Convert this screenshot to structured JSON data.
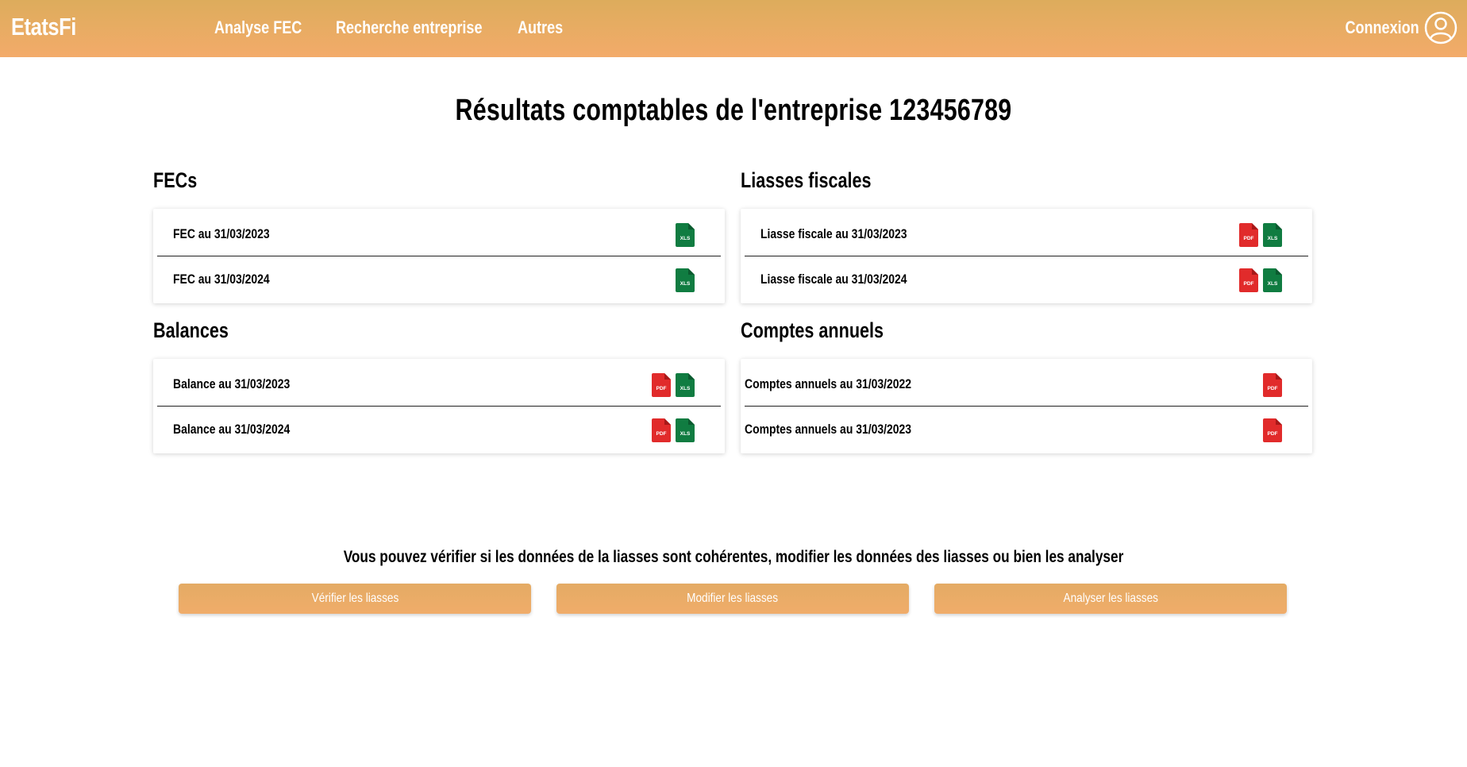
{
  "brand": "EtatsFi",
  "nav": {
    "items": [
      "Analyse FEC",
      "Recherche entreprise",
      "Autres"
    ],
    "login_label": "Connexion"
  },
  "page_title": "Résultats comptables de l'entreprise 123456789",
  "sections": {
    "fecs": {
      "title": "FECs",
      "rows": [
        {
          "label": "FEC au 31/03/2023",
          "icons": [
            "xls-file-icon"
          ]
        },
        {
          "label": "FEC au 31/03/2024",
          "icons": [
            "xls-file-icon"
          ]
        }
      ]
    },
    "liasses": {
      "title": "Liasses fiscales",
      "rows": [
        {
          "label": "Liasse fiscale au 31/03/2023",
          "icons": [
            "pdf-file-icon",
            "xls-file-icon"
          ]
        },
        {
          "label": "Liasse fiscale au 31/03/2024",
          "icons": [
            "pdf-file-icon",
            "xls-file-icon"
          ]
        }
      ]
    },
    "balances": {
      "title": "Balances",
      "rows": [
        {
          "label": "Balance au 31/03/2023",
          "icons": [
            "pdf-file-icon",
            "xls-file-icon"
          ]
        },
        {
          "label": "Balance au 31/03/2024",
          "icons": [
            "pdf-file-icon",
            "xls-file-icon"
          ]
        }
      ]
    },
    "comptes": {
      "title": "Comptes annuels",
      "rows": [
        {
          "label": "Comptes annuels au 31/03/2022",
          "icons": [
            "pdf-file-icon"
          ]
        },
        {
          "label": "Comptes annuels au 31/03/2023",
          "icons": [
            "pdf-file-icon"
          ]
        }
      ]
    }
  },
  "icon_labels": {
    "pdf": "PDF",
    "xls": "XLS"
  },
  "footer": {
    "text": "Vous pouvez vérifier si les données de la liasses sont cohérentes, modifier les données des liasses ou bien les analyser",
    "buttons": [
      "Vérifier les liasses",
      "Modifier les liasses",
      "Analyser les liasses"
    ]
  },
  "colors": {
    "header_gradient_top": "#ddac5c",
    "header_gradient_bottom": "#f3ab6a",
    "pdf_red": "#e12b2b",
    "xls_green": "#107c41",
    "button": "#eaab66"
  }
}
